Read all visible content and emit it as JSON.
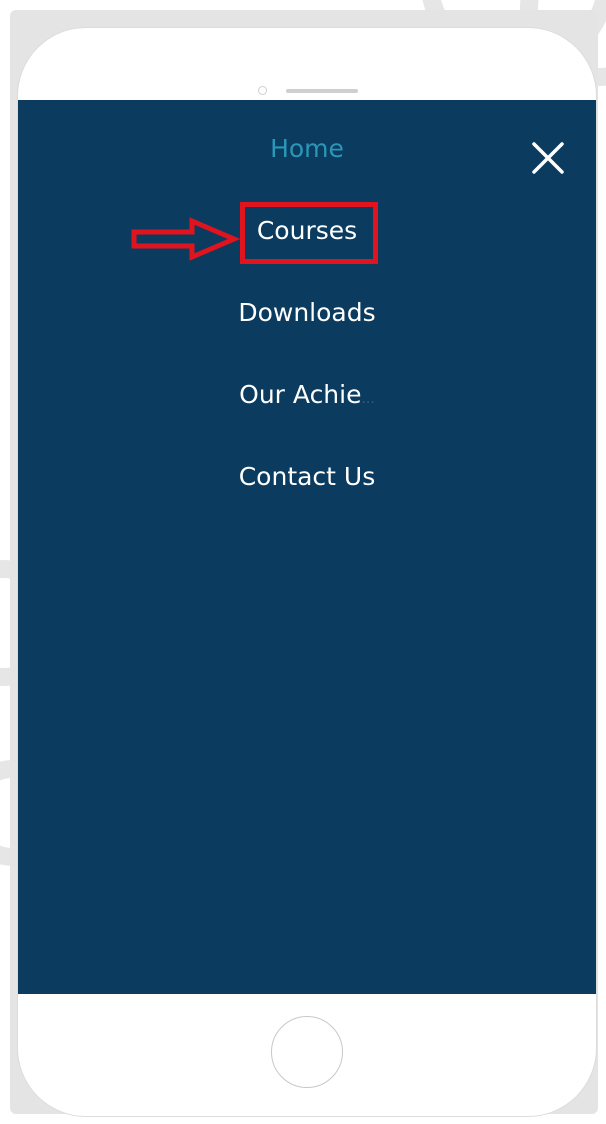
{
  "menu": {
    "items": [
      {
        "label": "Home",
        "active": true
      },
      {
        "label": "Courses",
        "active": false
      },
      {
        "label": "Downloads",
        "active": false
      },
      {
        "label": "Our Achie",
        "active": false
      },
      {
        "label": "Contact Us",
        "active": false
      }
    ],
    "truncation_mark": "..."
  },
  "icons": {
    "close": "close-icon",
    "arrow": "right-arrow-annotation-icon"
  },
  "colors": {
    "screen_bg": "#0b3b5e",
    "active_item": "#2a97b8",
    "menu_text": "#ffffff",
    "annotation_red": "#e0141e"
  }
}
